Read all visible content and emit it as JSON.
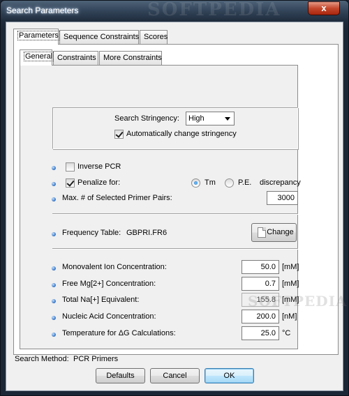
{
  "window": {
    "title": "Search Parameters",
    "close_label": "x",
    "watermark": "SOFTPEDIA"
  },
  "outer_tabs": [
    "Parameters",
    "Sequence Constraints",
    "Scores"
  ],
  "inner_tabs": [
    "General",
    "Constraints",
    "More Constraints"
  ],
  "stringency": {
    "label": "Search Stringency:",
    "value": "High",
    "auto_label": "Automatically change stringency",
    "auto_checked": true
  },
  "options": {
    "inverse_pcr_label": "Inverse PCR",
    "inverse_pcr_checked": false,
    "penalize_label": "Penalize for:",
    "penalize_checked": true,
    "tm_label": "Tm",
    "pe_label": "P.E.",
    "discrepancy_label": "discrepancy",
    "selected_radio": "Tm",
    "max_pairs_label": "Max. # of Selected Primer Pairs:",
    "max_pairs_value": "3000"
  },
  "frequency": {
    "label": "Frequency Table:",
    "value": "GBPRI.FR6",
    "change_label": "Change"
  },
  "concentrations": [
    {
      "label": "Monovalent Ion Concentration:",
      "value": "50.0",
      "unit": "[mM]",
      "disabled": false
    },
    {
      "label": "Free Mg[2+] Concentration:",
      "value": "0.7",
      "unit": "[mM]",
      "disabled": false
    },
    {
      "label": "Total Na[+] Equivalent:",
      "value": "155.8",
      "unit": "[mM]",
      "disabled": true
    },
    {
      "label": "Nucleic Acid Concentration:",
      "value": "200.0",
      "unit": "[nM]",
      "disabled": false
    },
    {
      "label": "Temperature for ΔG Calculations:",
      "value": "25.0",
      "unit": "°C",
      "disabled": false
    }
  ],
  "footer": {
    "method_label": "Search Method:",
    "method_value": "PCR Primers",
    "defaults_label": "Defaults",
    "cancel_label": "Cancel",
    "ok_label": "OK"
  }
}
